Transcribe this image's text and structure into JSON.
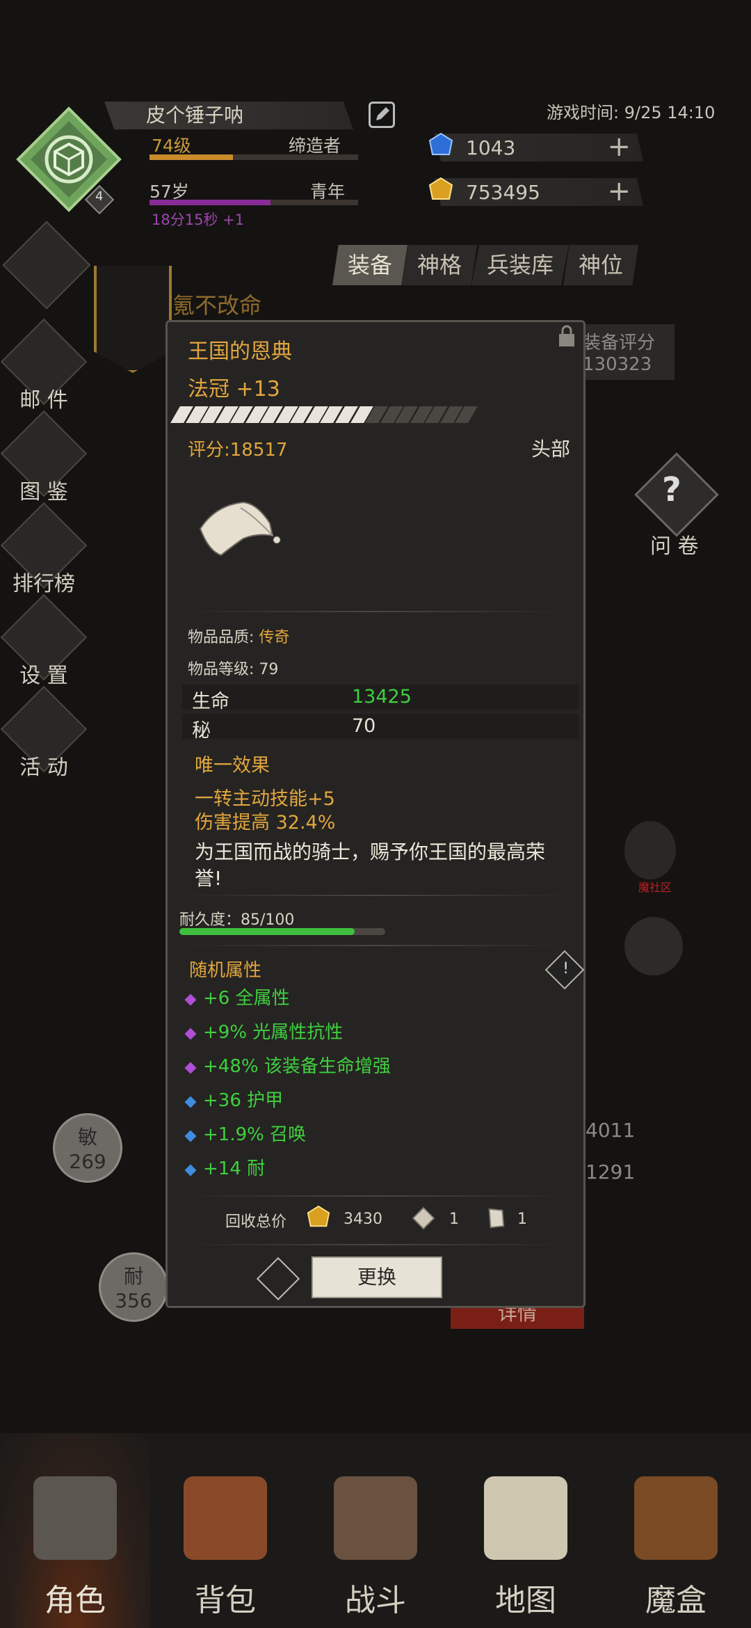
{
  "player": {
    "name": "皮个锤子呐",
    "level": "74级",
    "job": "缔造者",
    "age": "57岁",
    "stage": "青年",
    "timer": "18分15秒 +1",
    "badge": "4",
    "level_progress": 0.4,
    "age_progress": 0.58
  },
  "game_time": "游戏时间: 9/25 14:10",
  "currency": {
    "blue_gem": "1043",
    "gold_gem": "753495"
  },
  "tabs": [
    "装备",
    "神格",
    "兵装库",
    "神位"
  ],
  "left_menu": [
    {
      "label": "邮 件",
      "icon": "mail-icon"
    },
    {
      "label": "图 鉴",
      "icon": "book-icon"
    },
    {
      "label": "排行榜",
      "icon": "ranking-icon"
    },
    {
      "label": "设 置",
      "icon": "gear-icon"
    },
    {
      "label": "活 动",
      "icon": "activity-icon"
    }
  ],
  "motto": "氪不改命",
  "outer_score": {
    "label": "装备评分",
    "value": "130323"
  },
  "item": {
    "name": "王国的恩典",
    "type": "法冠 +13",
    "enhance_level": 13,
    "enhance_max": 20,
    "score": "评分:18517",
    "slot": "头部",
    "quality_label": "物品品质: ",
    "quality_value": "传奇",
    "item_level": "物品等级: 79",
    "stats": [
      {
        "name": "生命",
        "value": "13425"
      },
      {
        "name": "秘",
        "value": "70"
      }
    ],
    "unique_title": "唯一效果",
    "unique_effects": [
      "一转主动技能+5",
      "伤害提高 32.4%"
    ],
    "flavor": "为王国而战的骑士，赐予你王国的最高荣誉!",
    "durability_label": "耐久度：85/100",
    "durability": 0.85,
    "random_title": "随机属性",
    "random_attrs": [
      {
        "text": "+6  全属性",
        "dot": "#b04fd6"
      },
      {
        "text": "+9%  光属性抗性",
        "dot": "#b04fd6"
      },
      {
        "text": "+48%  该装备生命增强",
        "dot": "#b04fd6"
      },
      {
        "text": "+36  护甲",
        "dot": "#3f8ce0"
      },
      {
        "text": "+1.9%  召唤",
        "dot": "#3f8ce0"
      },
      {
        "text": "+14  耐",
        "dot": "#3f8ce0"
      }
    ],
    "recycle_label": "回收总价",
    "recycle_gold": "3430",
    "recycle_item1": "1",
    "recycle_item2": "1",
    "swap_label": "更换"
  },
  "right": {
    "survey_label": "问 卷",
    "community_label": "魔社区",
    "bg_stat1": "4011",
    "bg_stat2": "1291",
    "detail_label": "详情"
  },
  "circles": [
    {
      "name": "敏",
      "value": "269"
    },
    {
      "name": "耐",
      "value": "356"
    }
  ],
  "bottom_nav": [
    "角色",
    "背包",
    "战斗",
    "地图",
    "魔盒"
  ]
}
